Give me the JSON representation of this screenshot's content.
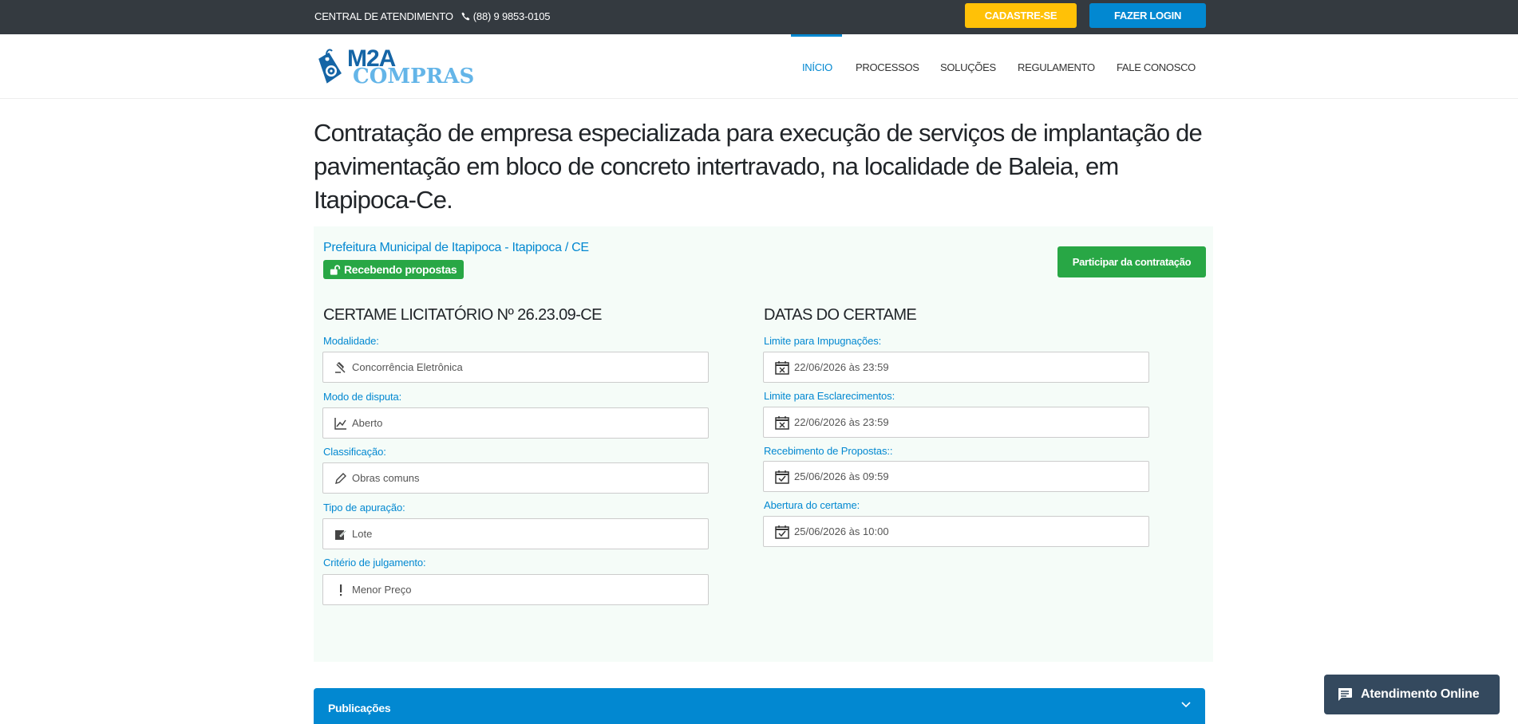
{
  "topbar": {
    "contact_label": "CENTRAL DE ATENDIMENTO",
    "phone": "(88) 9 9853-0105",
    "register_label": "CADASTRE-SE",
    "login_label": "FAZER LOGIN"
  },
  "logo": {
    "line1": "M2A",
    "line2": "COMPRAS"
  },
  "nav": {
    "items": [
      {
        "label": "INÍCIO",
        "active": true
      },
      {
        "label": "PROCESSOS",
        "active": false
      },
      {
        "label": "SOLUÇÕES",
        "active": false
      },
      {
        "label": "REGULAMENTO",
        "active": false
      },
      {
        "label": "FALE CONOSCO",
        "active": false
      }
    ]
  },
  "page": {
    "title": "Contratação de empresa especializada para execução de serviços de implantação de pavimentação em bloco de concreto intertravado, na localidade de Baleia, em Itapipoca-Ce."
  },
  "panel": {
    "organization": "Prefeitura Municipal de Itapipoca - Itapipoca / CE",
    "status": "Recebendo propostas",
    "participate_label": "Participar da contratação"
  },
  "certame": {
    "heading": "CERTAME LICITATÓRIO Nº 26.23.09-CE",
    "fields": [
      {
        "label": "Modalidade:",
        "value": "Concorrência Eletrônica",
        "icon": "gavel-icon"
      },
      {
        "label": "Modo de disputa:",
        "value": "Aberto",
        "icon": "chart-line-icon"
      },
      {
        "label": "Classificação:",
        "value": "Obras comuns",
        "icon": "pencil-icon"
      },
      {
        "label": "Tipo de apuração:",
        "value": "Lote",
        "icon": "edit-icon"
      },
      {
        "label": "Critério de julgamento:",
        "value": "Menor Preço",
        "icon": "exclamation-icon"
      }
    ]
  },
  "dates": {
    "heading": "DATAS DO CERTAME",
    "fields": [
      {
        "label": "Limite para Impugnações:",
        "value": "22/06/2026 às 23:59",
        "icon": "calendar-x-icon"
      },
      {
        "label": "Limite para Esclarecimentos:",
        "value": "22/06/2026 às 23:59",
        "icon": "calendar-x-icon"
      },
      {
        "label": "Recebimento de Propostas::",
        "value": "25/06/2026 às 09:59",
        "icon": "calendar-check-icon"
      },
      {
        "label": "Abertura do certame:",
        "value": "25/06/2026 às 10:00",
        "icon": "calendar-check-icon"
      }
    ]
  },
  "publications": {
    "label": "Publicações"
  },
  "chat": {
    "label": "Atendimento Online"
  },
  "colors": {
    "primary": "#0288d1",
    "success": "#28a745",
    "warning": "#ffc107",
    "topbar": "#343a40",
    "panel_bg": "#f5fcf8",
    "chat_bg": "#34495e"
  }
}
